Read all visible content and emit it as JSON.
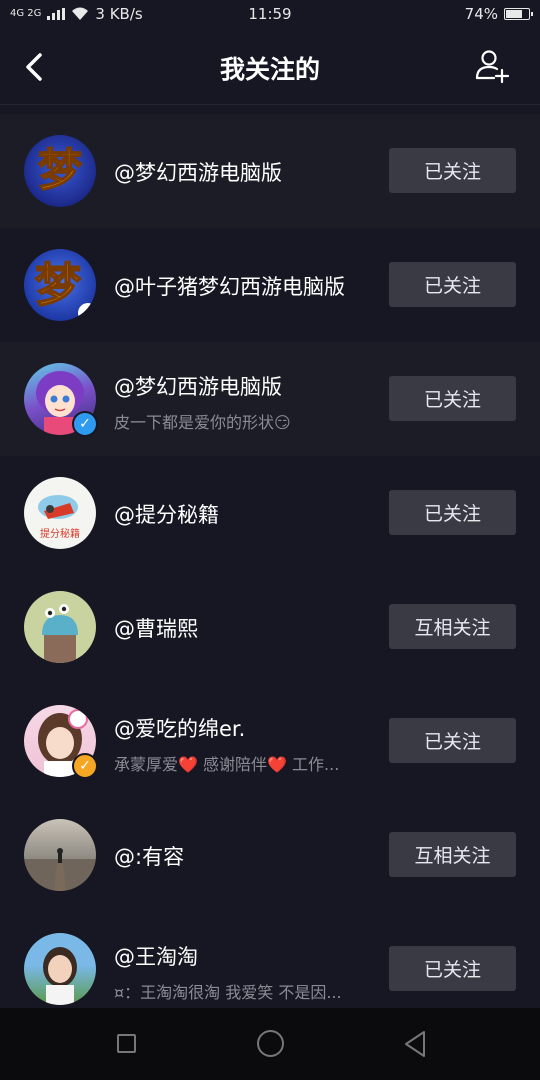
{
  "status_bar": {
    "signal": "4G 2G",
    "speed": "3 KB/s",
    "time": "11:59",
    "battery": "74%",
    "battery_level": 0.74
  },
  "header": {
    "title": "我关注的",
    "back_icon": "chevron-left-icon",
    "add_icon": "add-friend-icon"
  },
  "colors": {
    "background": "#161722",
    "button": "#393a44",
    "verified_blue": "#2f9bf0",
    "verified_orange": "#f5a623"
  },
  "follows": [
    {
      "name": "@梦幻西游电脑版",
      "bio": "",
      "button": "已关注"
    },
    {
      "name": "@叶子猪梦幻西游电脑版",
      "bio": "",
      "button": "已关注"
    },
    {
      "name": "@梦幻西游电脑版",
      "bio": "皮一下都是爱你的形状😏",
      "button": "已关注",
      "verified": "blue"
    },
    {
      "name": "@提分秘籍",
      "bio": "",
      "button": "已关注"
    },
    {
      "name": "@曹瑞熙",
      "bio": "",
      "button": "互相关注"
    },
    {
      "name": "@爱吃的绵er.",
      "bio": "承蒙厚爱❤️ 感谢陪伴❤️ 工作...",
      "button": "已关注",
      "verified": "orange"
    },
    {
      "name": "@:有容",
      "bio": "",
      "button": "互相关注"
    },
    {
      "name": "@王淘淘",
      "bio": "¤：王淘淘很淘 我爱笑 不是因...",
      "button": "已关注"
    }
  ],
  "nav": {
    "recent_icon": "square-icon",
    "home_icon": "circle-icon",
    "back_icon": "triangle-back-icon"
  }
}
